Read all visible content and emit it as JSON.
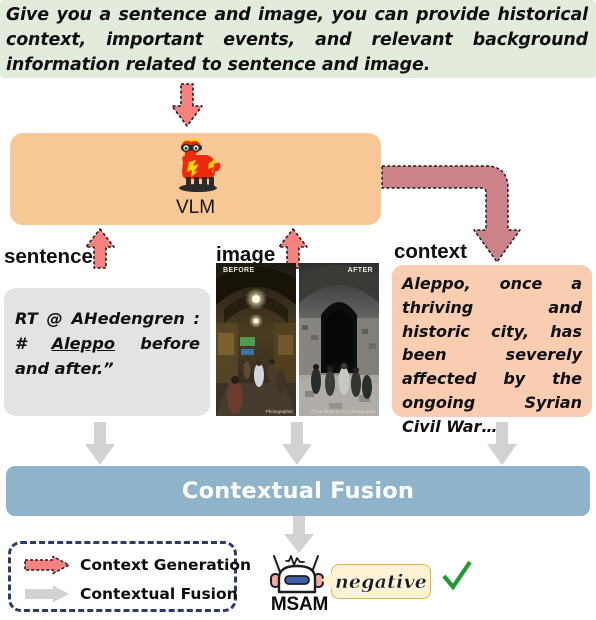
{
  "instruction": {
    "text": "Give you a sentence and image, you can provide historical context, important events, and relevant background information related to sentence and image.",
    "background_color": "#e3ecdc"
  },
  "model": {
    "label": "VLM",
    "icon": "llama-icon",
    "box_color": "#f8c796"
  },
  "inputs": {
    "sentence": {
      "label": "sentence",
      "text_before_link": "RT @ AHedengren : # ",
      "link_text": "Aleppo",
      "text_after_link": " before and after.”",
      "box_color": "#e3e3e3"
    },
    "image": {
      "label": "image",
      "photos": [
        {
          "caption": "BEFORE",
          "credit": "Photographer"
        },
        {
          "caption": "AFTER",
          "credit": "Photo taken by the photographer"
        }
      ]
    },
    "context": {
      "label": "context",
      "text": "Aleppo, once a thriving and historic city, has been severely affected by the ongoing Syrian Civil War…",
      "box_color": "#f8cdb2"
    }
  },
  "fusion": {
    "label": "Contextual Fusion",
    "bar_color": "#8fb4c9",
    "text_color": "#ffffff"
  },
  "legend": {
    "items": [
      {
        "label": "Context Generation",
        "arrow_type": "red-dashed-arrow",
        "color": "#f5827e"
      },
      {
        "label": "Contextual Fusion",
        "arrow_type": "gray-arrow",
        "color": "#d2d2d2"
      }
    ],
    "border_color": "#2b3c6b"
  },
  "output": {
    "model_label": "MSAM",
    "model_icon": "robot-icon",
    "sentiment": "negative",
    "sentiment_bubble_color": "#fdf3d4",
    "verdict_icon": "green-check-icon",
    "verdict_color": "#1c9c2f"
  },
  "colors": {
    "red_arrow": "#f5827e",
    "rose_arrow": "#cc8388",
    "gray_arrow": "#d2d2d2",
    "arrow_border": "#262626"
  }
}
